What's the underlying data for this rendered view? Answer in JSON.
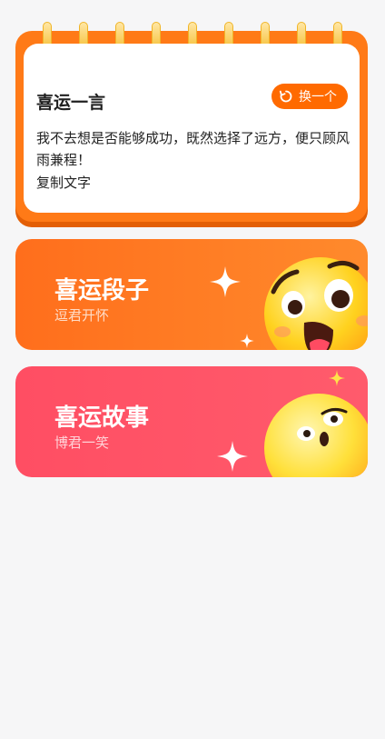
{
  "quote": {
    "title": "喜运一言",
    "refresh_label": "换一个",
    "text": "我不去想是否能够成功，既然选择了远方，便只顾风雨兼程！",
    "copy_label": "复制文字",
    "colors": {
      "frame": "#ff7a17",
      "button": "#ff6a00"
    },
    "icons": {
      "refresh": "refresh-icon"
    }
  },
  "cards": [
    {
      "title": "喜运段子",
      "subtitle": "逗君开怀",
      "color": "#ff7a22",
      "icon": "laughing-emoji-icon"
    },
    {
      "title": "喜运故事",
      "subtitle": "博君一笑",
      "color": "#ff5266",
      "icon": "surprised-emoji-icon"
    }
  ]
}
